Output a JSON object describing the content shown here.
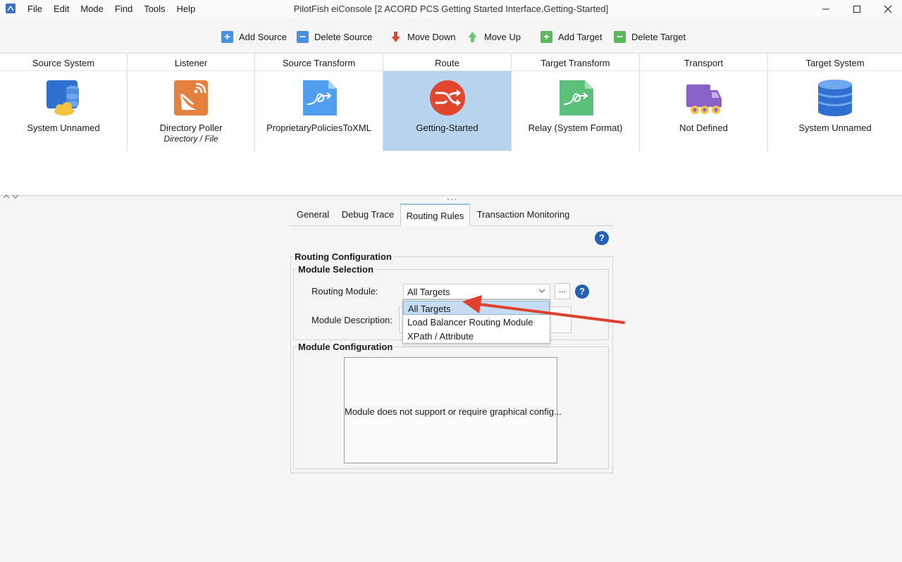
{
  "window": {
    "title": "PilotFish eiConsole [2 ACORD PCS Getting Started Interface.Getting-Started]",
    "menu": [
      "File",
      "Edit",
      "Mode",
      "Find",
      "Tools",
      "Help"
    ]
  },
  "toolbar": {
    "add_source": "Add Source",
    "delete_source": "Delete Source",
    "move_down": "Move Down",
    "move_up": "Move Up",
    "add_target": "Add Target",
    "delete_target": "Delete Target"
  },
  "stages": [
    {
      "header": "Source System",
      "name": "System Unnamed",
      "icon": "database-cloud-icon"
    },
    {
      "header": "Listener",
      "name": "Directory Poller",
      "sub": "Directory / File",
      "icon": "satellite-dish-icon"
    },
    {
      "header": "Source Transform",
      "name": "ProprietaryPoliciesToXML",
      "icon": "transform-document-icon"
    },
    {
      "header": "Route",
      "name": "Getting-Started",
      "icon": "route-icon"
    },
    {
      "header": "Target Transform",
      "name": "Relay (System Format)",
      "icon": "transform-document-icon"
    },
    {
      "header": "Transport",
      "name": "Not Defined",
      "icon": "truck-icon"
    },
    {
      "header": "Target System",
      "name": "System Unnamed",
      "icon": "database-icon"
    }
  ],
  "tabs": [
    "General",
    "Debug Trace",
    "Routing Rules",
    "Transaction Monitoring"
  ],
  "active_tab": "Routing Rules",
  "routing": {
    "config_title": "Routing Configuration",
    "module_selection_title": "Module Selection",
    "routing_module_label": "Routing Module:",
    "routing_module_value": "All Targets",
    "ellipsis": "...",
    "module_description_label": "Module Description:",
    "dropdown_options": [
      "All Targets",
      "Load Balancer Routing Module",
      "XPath / Attribute"
    ],
    "module_config_title": "Module Configuration",
    "module_config_message": "Module does not support or require graphical config..."
  },
  "help_glyph": "?",
  "colors": {
    "selected_stage": "#b6d4ee",
    "help_blue": "#2460b8",
    "annotation_arrow": "#e0412e",
    "add_icon": "#4a90e2",
    "add_target_icon": "#5cb85c"
  }
}
